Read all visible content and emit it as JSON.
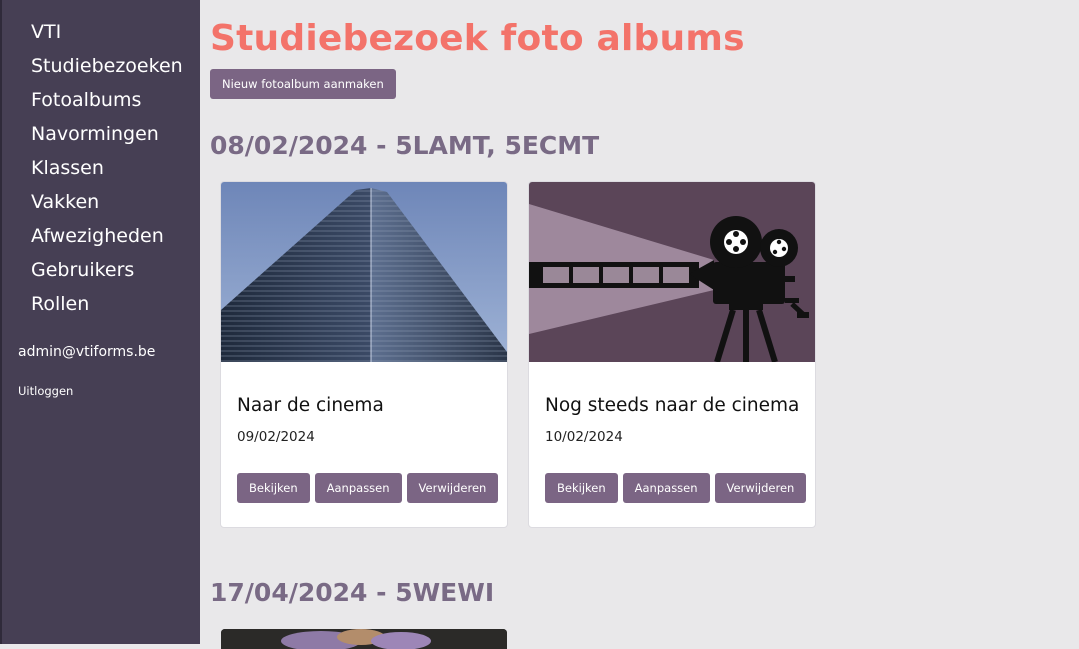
{
  "sidebar": {
    "items": [
      {
        "label": "VTI"
      },
      {
        "label": "Studiebezoeken"
      },
      {
        "label": "Fotoalbums"
      },
      {
        "label": "Navormingen"
      },
      {
        "label": "Klassen"
      },
      {
        "label": "Vakken"
      },
      {
        "label": "Afwezigheden"
      },
      {
        "label": "Gebruikers"
      },
      {
        "label": "Rollen"
      }
    ],
    "user_email": "admin@vtiforms.be",
    "logout_label": "Uitloggen"
  },
  "main": {
    "title": "Studiebezoek foto albums",
    "new_album_label": "Nieuw fotoalbum aanmaken",
    "groups": [
      {
        "heading": "08/02/2024 - 5LAMT, 5ECMT",
        "albums": [
          {
            "name": "Naar de cinema",
            "date": "09/02/2024",
            "image": "skyscraper-photo"
          },
          {
            "name": "Nog steeds naar de cinema",
            "date": "10/02/2024",
            "image": "film-projector-illustration"
          }
        ]
      },
      {
        "heading": "17/04/2024 - 5WEWI",
        "albums": []
      }
    ],
    "card_actions": {
      "view": "Bekijken",
      "edit": "Aanpassen",
      "delete": "Verwijderen"
    }
  },
  "colors": {
    "sidebar_bg": "#463f54",
    "title": "#f3736a",
    "heading": "#796a85",
    "button": "#7b6584",
    "page_bg": "#e9e8ea"
  }
}
